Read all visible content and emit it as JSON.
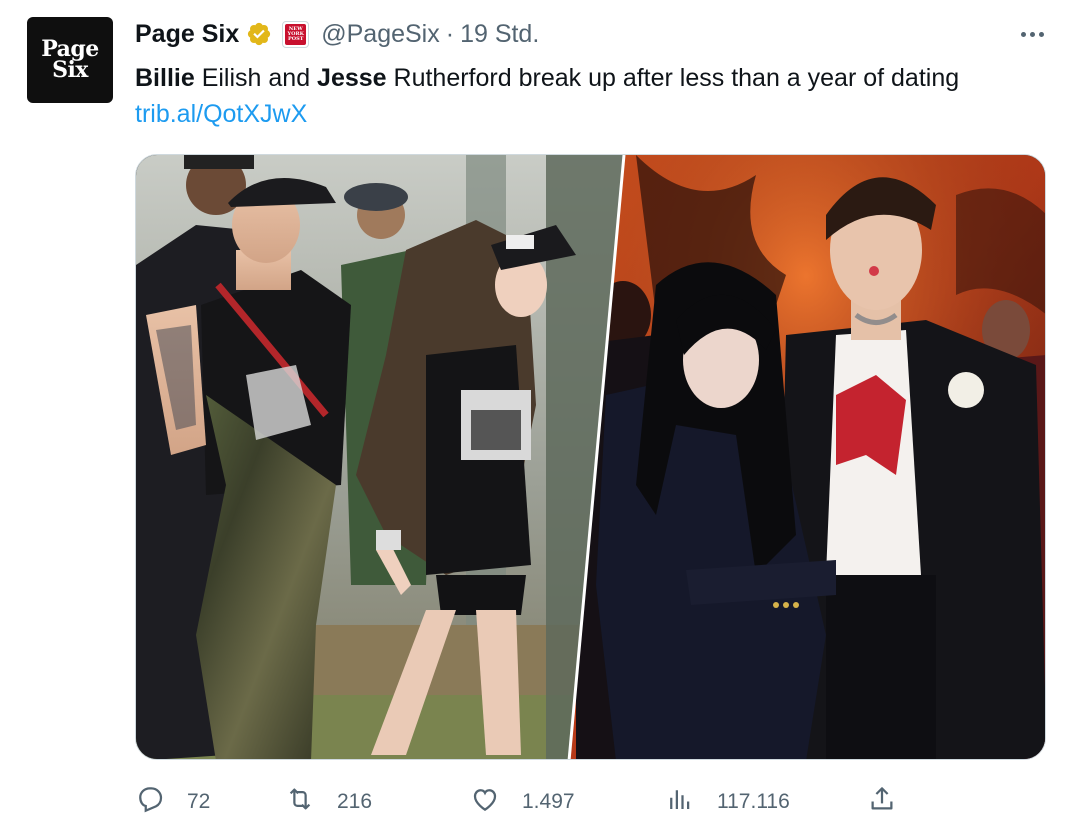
{
  "account": {
    "avatar_line1": "Page",
    "avatar_line2": "Six",
    "name": "Page Six",
    "handle": "@PageSix",
    "time": "19 Std.",
    "affiliate_badge": "New York Post"
  },
  "tweet": {
    "segments": [
      {
        "text": "Billie",
        "bold": true
      },
      {
        "text": " Eilish and ",
        "bold": false
      },
      {
        "text": "Jesse",
        "bold": true
      },
      {
        "text": " Rutherford break up after less than a year of dating",
        "bold": false
      }
    ],
    "link": "trib.al/QotXJwX"
  },
  "media": {
    "left_photo": "couple-walking-at-festival",
    "right_photo": "couple-posing-formal-event"
  },
  "actions": {
    "replies": "72",
    "retweets": "216",
    "likes": "1.497",
    "views": "117.116"
  },
  "icons": {
    "reply": "reply-icon",
    "retweet": "retweet-icon",
    "like": "heart-icon",
    "views": "views-icon",
    "share": "share-icon",
    "more": "more-icon",
    "verified": "verified-badge-icon"
  },
  "colors": {
    "link": "#1d9bf0",
    "secondary_text": "#536471",
    "verified_gold": "#e2b719",
    "affiliate_red": "#c8102e"
  }
}
